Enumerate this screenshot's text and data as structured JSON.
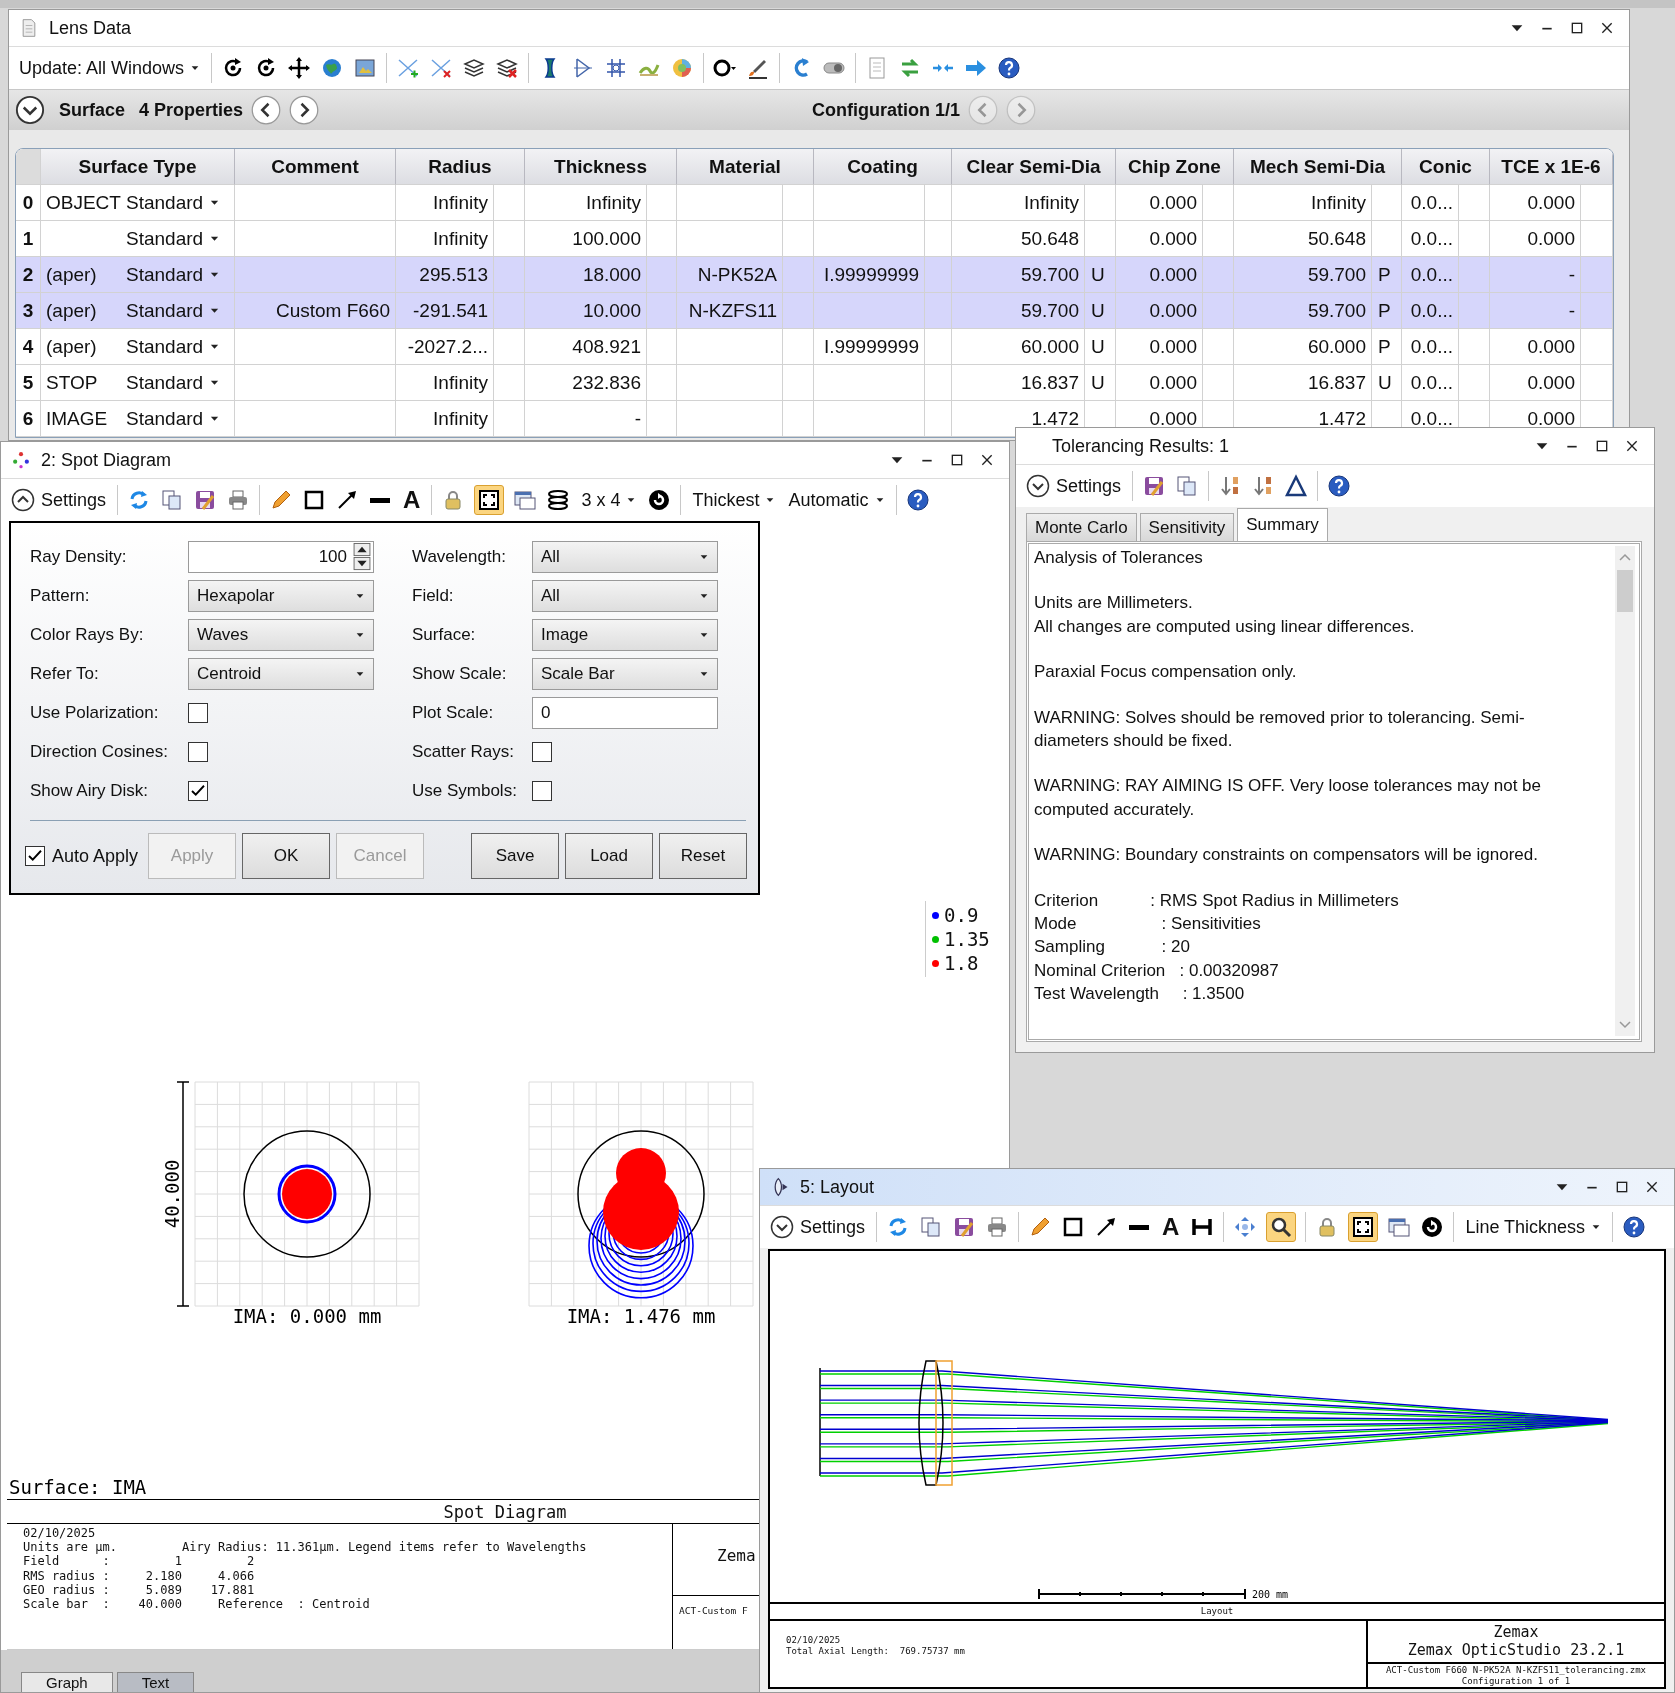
{
  "lens_data": {
    "title": "Lens Data",
    "toolbar": [
      {
        "kind": "dropdown",
        "label": "Update: All Windows"
      }
    ],
    "surface_bar": {
      "expanded": false,
      "section": "Surface",
      "properties": "4 Properties",
      "configuration": "Configuration 1/1",
      "configuration_nav_disabled": true
    },
    "columns": [
      "Surface Type",
      "Comment",
      "Radius",
      "Thickness",
      "Material",
      "Coating",
      "Clear Semi-Dia",
      "Chip Zone",
      "Mech Semi-Dia",
      "Conic",
      "TCE x 1E-6"
    ],
    "rows": [
      {
        "number": "0",
        "label": "OBJECT",
        "type": "Standard",
        "radius": "Infinity",
        "thickness": "Infinity",
        "clear_semi_dia": "Infinity",
        "chip_zone": "0.000",
        "mech_semi_dia": "Infinity",
        "conic": "0.0...",
        "tce": "0.000",
        "selected": false
      },
      {
        "number": "1",
        "type": "Standard",
        "radius": "Infinity",
        "thickness": "100.000",
        "clear_semi_dia": "50.648",
        "chip_zone": "0.000",
        "mech_semi_dia": "50.648",
        "conic": "0.0...",
        "tce": "0.000",
        "selected": false
      },
      {
        "number": "2",
        "label": "(aper)",
        "type": "Standard",
        "radius": "295.513",
        "thickness": "18.000",
        "material": "N-PK52A",
        "coating": "I.99999999",
        "clear_semi_dia": "59.700",
        "clear_semi_dia_solve": "U",
        "chip_zone": "0.000",
        "mech_semi_dia": "59.700",
        "mech_semi_dia_solve": "P",
        "conic": "0.0...",
        "tce": "-",
        "selected": true
      },
      {
        "number": "3",
        "label": "(aper)",
        "type": "Standard",
        "comment": "Custom F660",
        "radius": "-291.541",
        "thickness": "10.000",
        "material": "N-KZFS11",
        "clear_semi_dia": "59.700",
        "clear_semi_dia_solve": "U",
        "chip_zone": "0.000",
        "mech_semi_dia": "59.700",
        "mech_semi_dia_solve": "P",
        "conic": "0.0...",
        "tce": "-",
        "selected": true
      },
      {
        "number": "4",
        "label": "(aper)",
        "type": "Standard",
        "radius": "-2027.2...",
        "thickness": "408.921",
        "coating": "I.99999999",
        "clear_semi_dia": "60.000",
        "clear_semi_dia_solve": "U",
        "chip_zone": "0.000",
        "mech_semi_dia": "60.000",
        "mech_semi_dia_solve": "P",
        "conic": "0.0...",
        "tce": "0.000",
        "selected": false
      },
      {
        "number": "5",
        "label": "STOP",
        "type": "Standard",
        "radius": "Infinity",
        "thickness": "232.836",
        "clear_semi_dia": "16.837",
        "clear_semi_dia_solve": "U",
        "chip_zone": "0.000",
        "mech_semi_dia": "16.837",
        "mech_semi_dia_solve": "U",
        "conic": "0.0...",
        "tce": "0.000",
        "selected": false
      },
      {
        "number": "6",
        "label": "IMAGE",
        "type": "Standard",
        "radius": "Infinity",
        "thickness": "-",
        "clear_semi_dia": "1.472",
        "chip_zone": "0.000",
        "mech_semi_dia": "1.472",
        "conic": "0.0...",
        "tce": "0.000",
        "selected": false
      }
    ]
  },
  "spot_diagram": {
    "title": "2: Spot Diagram",
    "toolbar": [
      {
        "kind": "settings",
        "label": "Settings",
        "expanded": true
      },
      {
        "kind": "glyph",
        "label": "A"
      },
      {
        "kind": "toggle",
        "on": true
      },
      {
        "kind": "dropdown",
        "label": "3 x 4"
      },
      {
        "kind": "dropdown",
        "label": "Thickest"
      },
      {
        "kind": "dropdown",
        "label": "Automatic"
      }
    ],
    "settings_left": [
      {
        "kind": "spin",
        "label": "Ray Density:",
        "value": "100"
      },
      {
        "kind": "dropdown",
        "label": "Pattern:",
        "value": "Hexapolar"
      },
      {
        "kind": "dropdown",
        "label": "Color Rays By:",
        "value": "Waves"
      },
      {
        "kind": "dropdown",
        "label": "Refer To:",
        "value": "Centroid"
      },
      {
        "kind": "checkbox",
        "label": "Use Polarization:",
        "checked": false
      },
      {
        "kind": "checkbox",
        "label": "Direction Cosines:",
        "checked": false
      },
      {
        "kind": "checkbox",
        "label": "Show Airy Disk:",
        "checked": true
      }
    ],
    "settings_right": [
      {
        "kind": "dropdown",
        "label": "Wavelength:",
        "value": "All"
      },
      {
        "kind": "dropdown",
        "label": "Field:",
        "value": "All"
      },
      {
        "kind": "dropdown",
        "label": "Surface:",
        "value": "Image"
      },
      {
        "kind": "dropdown",
        "label": "Show Scale:",
        "value": "Scale Bar"
      },
      {
        "kind": "text",
        "label": "Plot Scale:",
        "value": "0"
      },
      {
        "kind": "checkbox",
        "label": "Scatter Rays:",
        "checked": false
      },
      {
        "kind": "checkbox",
        "label": "Use Symbols:",
        "checked": false
      }
    ],
    "auto_apply": {
      "label": "Auto Apply",
      "checked": true
    },
    "buttons": [
      {
        "label": "Apply",
        "disabled": true
      },
      {
        "label": "OK",
        "disabled": false
      },
      {
        "label": "Cancel",
        "disabled": true
      }
    ],
    "file_buttons": [
      {
        "label": "Save"
      },
      {
        "label": "Load"
      },
      {
        "label": "Reset"
      }
    ],
    "legend": [
      {
        "label": "0.9",
        "color": "#0000ff"
      },
      {
        "label": "1.35",
        "color": "#00c000"
      },
      {
        "label": "1.8",
        "color": "#ff0000"
      }
    ],
    "scale_label": "40.000",
    "plots": [
      {
        "kind": "focused",
        "field_label": "IMA: 0.000 mm"
      },
      {
        "kind": "aberrated",
        "field_label": "IMA: 1.476 mm"
      }
    ],
    "surface_label": "Surface: IMA",
    "footer": {
      "title": "Spot Diagram",
      "lines": [
        "02/10/2025",
        "Units are µm.         Airy Radius: 11.361µm. Legend items refer to Wavelengths",
        "Field      :         1         2",
        "RMS radius :     2.180     4.066",
        "GEO radius :     5.089    17.881",
        "Scale bar  :    40.000     Reference  : Centroid"
      ],
      "company": "Zema",
      "file": "ACT-Custom F"
    },
    "tabs": [
      {
        "label": "Graph",
        "selected": true
      },
      {
        "label": "Text",
        "selected": false
      }
    ]
  },
  "tolerancing": {
    "title": "Tolerancing Results: 1",
    "toolbar": [
      {
        "kind": "settings",
        "label": "Settings",
        "expanded": false
      }
    ],
    "tabs": [
      {
        "label": "Monte Carlo",
        "selected": false
      },
      {
        "label": "Sensitivity",
        "selected": false
      },
      {
        "label": "Summary",
        "selected": true
      }
    ],
    "paragraphs": [
      [
        "Analysis of Tolerances"
      ],
      [
        "Units are Millimeters.",
        "All changes are computed using linear differences."
      ],
      [
        "Paraxial Focus compensation only."
      ],
      [
        "WARNING: Solves should be removed prior to tolerancing. Semi-diameters should be fixed."
      ],
      [
        "WARNING: RAY AIMING IS OFF. Very loose tolerances may not be computed accurately."
      ],
      [
        "WARNING: Boundary constraints on compensators will be ignored."
      ],
      [
        "Criterion           : RMS Spot Radius in Millimeters",
        "Mode                  : Sensitivities",
        "Sampling            : 20",
        "Nominal Criterion   : 0.00320987",
        "Test Wavelength     : 1.3500"
      ]
    ]
  },
  "layout": {
    "title": "5: Layout",
    "toolbar": [
      {
        "kind": "settings",
        "label": "Settings",
        "expanded": false
      },
      {
        "kind": "glyph",
        "label": "A"
      },
      {
        "kind": "toggle",
        "on": true
      },
      {
        "kind": "toggle",
        "on": true
      },
      {
        "kind": "dropdown",
        "label": "Line Thickness"
      }
    ],
    "scale_bar_label": "200 mm",
    "caption": "Layout",
    "footer_lines": [
      "02/10/2025",
      "Total Axial Length:  769.75737 mm"
    ],
    "brand_lines": [
      "Zemax",
      "Zemax OpticStudio 23.2.1"
    ],
    "file_lines": [
      "ACT-Custom F660 N-PK52A N-KZFS11_tolerancing.zmx",
      "Configuration 1 of 1"
    ]
  }
}
